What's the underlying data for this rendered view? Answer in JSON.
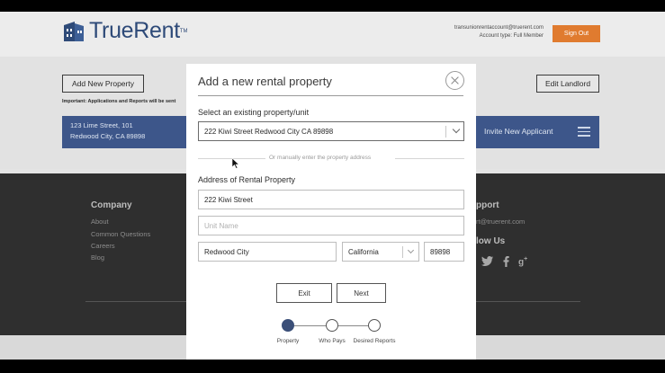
{
  "app": {
    "brand": "TrueRent",
    "trademark": "TM",
    "account_email": "transunionrentaccount@truerent.com",
    "account_type": "Account type: Full Member",
    "signout_label": "Sign Out"
  },
  "toolbar": {
    "add_property_label": "Add New Property",
    "edit_landlord_label": "Edit Landlord",
    "important_note": "Important: Applications and Reports will be sent"
  },
  "property_bar": {
    "street": "123 Lime Street, 101",
    "city": "Redwood City, CA 89898",
    "invite_label": "Invite New Applicant"
  },
  "footer": {
    "company_heading": "Company",
    "company_links": [
      "About",
      "Common Questions",
      "Careers",
      "Blog"
    ],
    "support_heading": "pport",
    "support_email": "rt@truerent.com",
    "follow_heading": "low Us",
    "social_icons": [
      "twitter-icon",
      "facebook-icon",
      "google-plus-icon"
    ]
  },
  "modal": {
    "title": "Add a new rental property",
    "existing_label": "Select an existing property/unit",
    "existing_value": "222 Kiwi Street Redwood City CA 89898",
    "or_text": "Or manually enter the property address",
    "address_label": "Address of Rental Property",
    "street_value": "222 Kiwi Street",
    "unit_placeholder": "Unit Name",
    "city_value": "Redwood City",
    "state_value": "California",
    "zip_value": "89898",
    "exit_label": "Exit",
    "next_label": "Next",
    "steps": [
      {
        "label": "Property",
        "active": true
      },
      {
        "label": "Who Pays",
        "active": false
      },
      {
        "label": "Desired Reports",
        "active": false
      }
    ]
  },
  "colors": {
    "brand_blue": "#2e4a78",
    "property_bar": "#3d568a",
    "signout_orange": "#e07b2f",
    "footer_dark": "#2f2f2f"
  }
}
